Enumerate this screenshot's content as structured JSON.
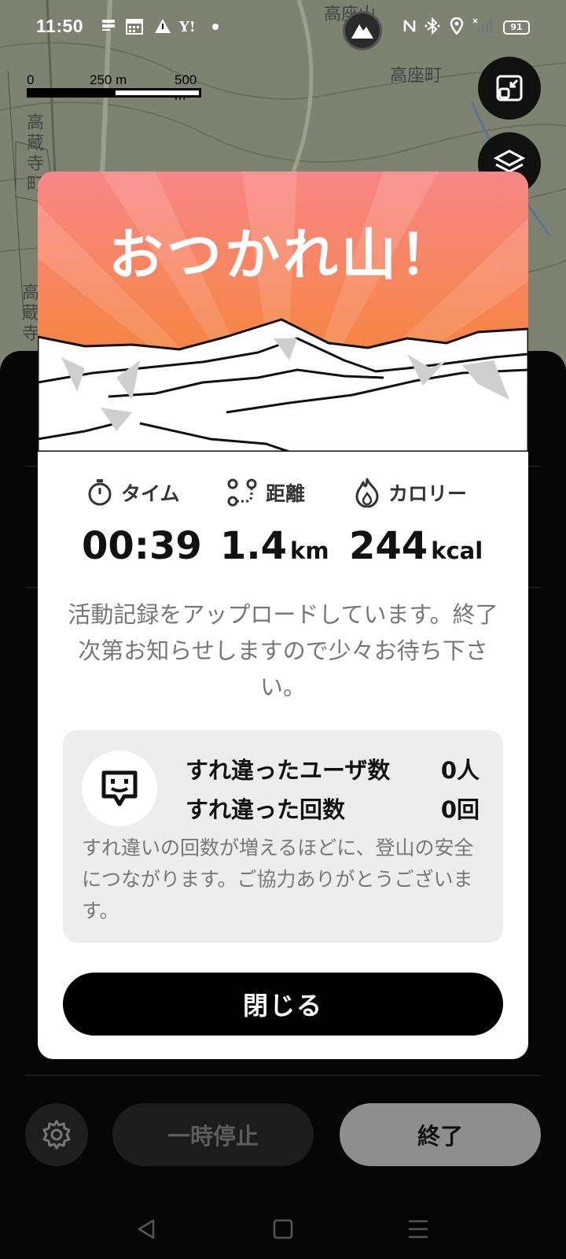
{
  "status_bar": {
    "time": "11:50",
    "battery": "91",
    "icons": [
      "notification-icon",
      "calendar-icon",
      "alert-icon",
      "yahoo-icon",
      "dot-icon",
      "nfc-icon",
      "bluetooth-icon",
      "location-icon",
      "signal-icon"
    ]
  },
  "map": {
    "labels": [
      "高座山",
      "高座町",
      "高蔵寺町",
      "高蔵寺"
    ],
    "scale": {
      "ticks": [
        "0",
        "250 m",
        "500 m"
      ]
    }
  },
  "modal": {
    "title": "おつかれ山！",
    "stats": {
      "time": {
        "label": "タイム",
        "value": "00:39",
        "unit": ""
      },
      "distance": {
        "label": "距離",
        "value": "1.4",
        "unit": "km"
      },
      "calorie": {
        "label": "カロリー",
        "value": "244",
        "unit": "kcal"
      }
    },
    "upload_message": "活動記録をアップロードしています。終了次第お知らせしますので少々お待ち下さい。",
    "passing": {
      "users_label": "すれ違ったユーザ数",
      "users_value": "0人",
      "count_label": "すれ違った回数",
      "count_value": "0回",
      "note": "すれ違いの回数が増えるほどに、登山の安全につながります。ご協力ありがとうございます。"
    },
    "close_label": "閉じる"
  },
  "bottom": {
    "pause_label": "一時停止",
    "end_label": "終了"
  },
  "colors": {
    "hero_top": "#f78787",
    "hero_bottom": "#f57b2e",
    "button": "#000000",
    "end_button": "#8e8e8e"
  }
}
